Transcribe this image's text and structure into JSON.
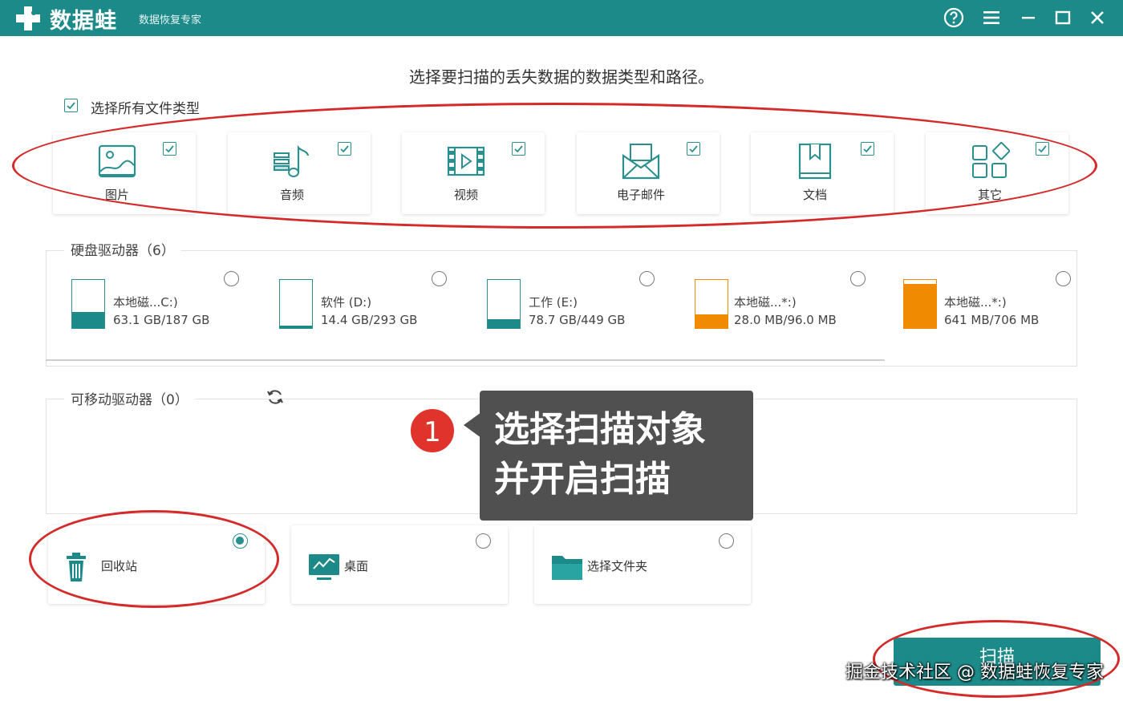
{
  "app": {
    "name": "数据蛙",
    "subtitle": "数据恢复专家"
  },
  "window_controls": [
    "help-icon",
    "menu-icon",
    "minimize-icon",
    "maximize-icon",
    "close-icon"
  ],
  "heading": "选择要扫描的丢失数据的数据类型和路径。",
  "select_all": {
    "label": "选择所有文件类型",
    "checked": true
  },
  "file_types": [
    {
      "label": "图片",
      "icon": "image-icon",
      "checked": true
    },
    {
      "label": "音频",
      "icon": "music-icon",
      "checked": true
    },
    {
      "label": "视频",
      "icon": "video-icon",
      "checked": true
    },
    {
      "label": "电子邮件",
      "icon": "email-icon",
      "checked": true
    },
    {
      "label": "文档",
      "icon": "document-icon",
      "checked": true
    },
    {
      "label": "其它",
      "icon": "apps-icon",
      "checked": true
    }
  ],
  "hard_drives": {
    "title": "硬盘驱动器（6）",
    "items": [
      {
        "name": "本地磁...C:)",
        "size": "63.1 GB/187 GB",
        "fill": 0.34,
        "color": "#1d8a8a"
      },
      {
        "name": "软件 (D:)",
        "size": "14.4 GB/293 GB",
        "fill": 0.05,
        "color": "#1d8a8a"
      },
      {
        "name": "工作 (E:)",
        "size": "78.7 GB/449 GB",
        "fill": 0.18,
        "color": "#1d8a8a"
      },
      {
        "name": "本地磁...*:)",
        "size": "28.0 MB/96.0 MB",
        "fill": 0.29,
        "color": "#f08a00"
      },
      {
        "name": "本地磁...*:)",
        "size": "641 MB/706 MB",
        "fill": 0.91,
        "color": "#f08a00"
      }
    ]
  },
  "removable": {
    "title": "可移动驱动器（0）",
    "refresh_icon": "refresh-icon"
  },
  "locations": [
    {
      "label": "回收站",
      "icon": "trash-icon",
      "selected": true
    },
    {
      "label": "桌面",
      "icon": "desktop-icon",
      "selected": false
    },
    {
      "label": "选择文件夹",
      "icon": "folder-icon",
      "selected": false
    }
  ],
  "callout": {
    "step": "1",
    "line1": "选择扫描对象",
    "line2": "并开启扫描"
  },
  "scan_button": "扫描",
  "watermark": "掘金技术社区 @ 数据蛙恢复专家",
  "colors": {
    "primary": "#1d8a8a",
    "orange": "#f08a00",
    "annotation": "#d42a2a",
    "callout_bg": "#505050"
  }
}
